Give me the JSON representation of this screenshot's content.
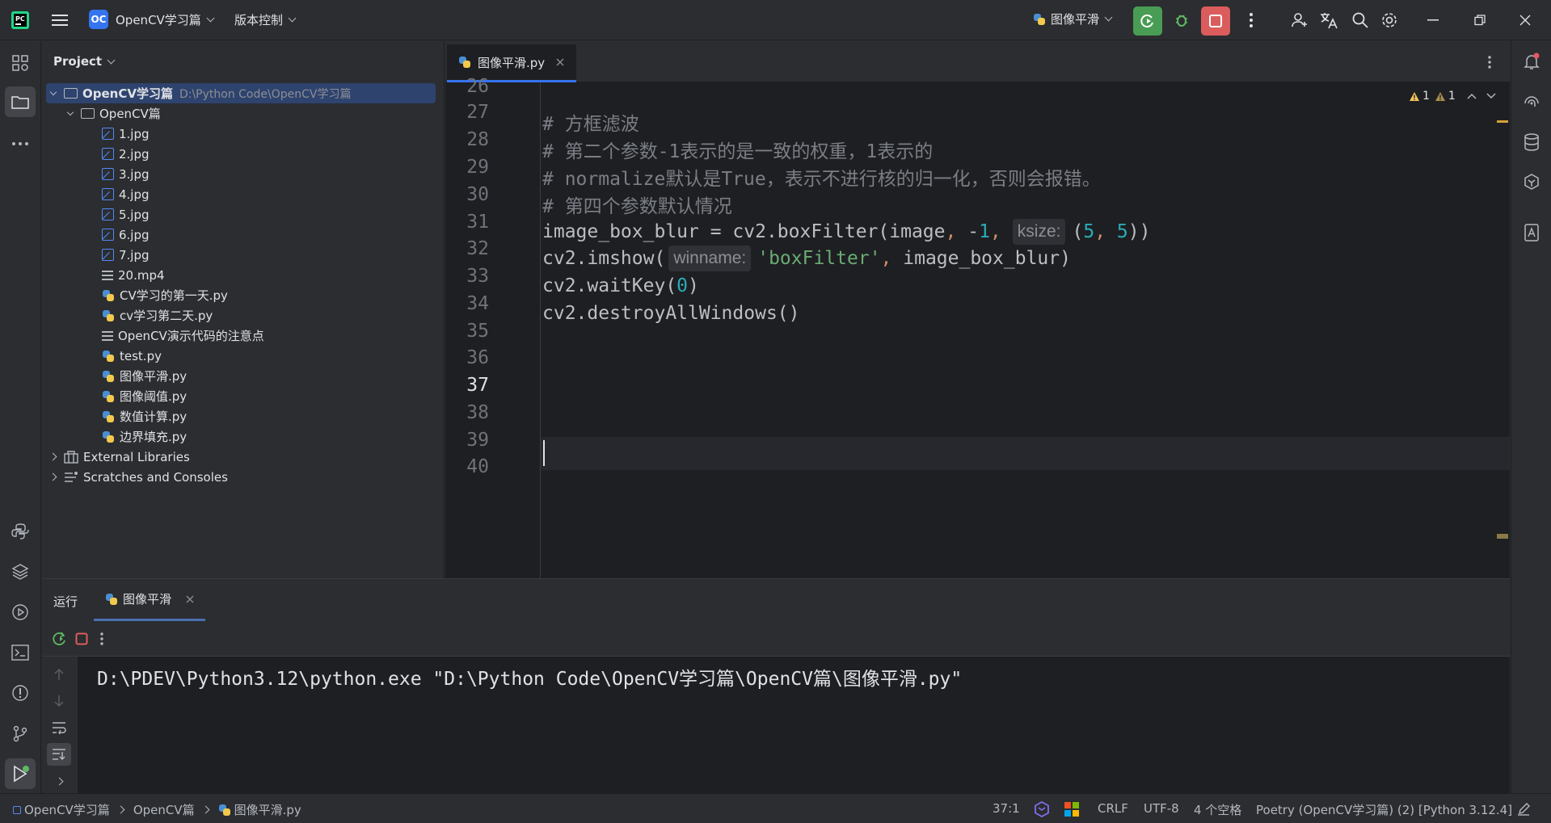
{
  "titlebar": {
    "project_badge": "OC",
    "project_name": "OpenCV学习篇",
    "vcs": "版本控制",
    "run_config": "图像平滑"
  },
  "project_panel": {
    "title": "Project",
    "root_name": "OpenCV学习篇",
    "root_path": "D:\\Python Code\\OpenCV学习篇",
    "folder": "OpenCV篇",
    "files": [
      {
        "name": "1.jpg",
        "type": "jpg"
      },
      {
        "name": "2.jpg",
        "type": "jpg"
      },
      {
        "name": "3.jpg",
        "type": "jpg"
      },
      {
        "name": "4.jpg",
        "type": "jpg"
      },
      {
        "name": "5.jpg",
        "type": "jpg"
      },
      {
        "name": "6.jpg",
        "type": "jpg"
      },
      {
        "name": "7.jpg",
        "type": "jpg"
      },
      {
        "name": "20.mp4",
        "type": "text"
      },
      {
        "name": "CV学习的第一天.py",
        "type": "py"
      },
      {
        "name": "cv学习第二天.py",
        "type": "py"
      },
      {
        "name": "OpenCV演示代码的注意点",
        "type": "text"
      },
      {
        "name": "test.py",
        "type": "py"
      },
      {
        "name": "图像平滑.py",
        "type": "py"
      },
      {
        "name": "图像阈值.py",
        "type": "py"
      },
      {
        "name": "数值计算.py",
        "type": "py"
      },
      {
        "name": "边界填充.py",
        "type": "py"
      }
    ],
    "external_libraries": "External Libraries",
    "scratches": "Scratches and Consoles"
  },
  "editor": {
    "tab_label": "图像平滑.py",
    "warnings": "1",
    "weak_warnings": "1",
    "line_numbers": [
      "26",
      "27",
      "28",
      "29",
      "30",
      "31",
      "32",
      "33",
      "34",
      "35",
      "36",
      "37",
      "38",
      "39",
      "40"
    ],
    "current_line": "37",
    "code": {
      "l27": "# 方框滤波",
      "l28": "# 第二个参数-1表示的是一致的权重，1表示的",
      "l29": "# normalize默认是True，表示不进行核的归一化，否则会报错。",
      "l30": "# 第四个参数默认情况",
      "l31_a": "image_box_blur = cv2.boxFilter(image",
      "l31_comma1": ",",
      "l31_b": " -",
      "l31_n1": "1",
      "l31_comma2": ",",
      "l31_hint": "ksize:",
      "l31_c": "(",
      "l31_n2": "5",
      "l31_comma3": ",",
      "l31_n3": " 5",
      "l31_d": "))",
      "l32_a": "cv2.imshow(",
      "l32_hint": "winname:",
      "l32_str": "'boxFilter'",
      "l32_comma": ",",
      "l32_b": " image_box_blur)",
      "l33_a": "cv2.waitKey(",
      "l33_n": "0",
      "l33_b": ")",
      "l34": "cv2.destroyAllWindows()"
    }
  },
  "run_panel": {
    "title": "运行",
    "tab_label": "图像平滑",
    "output": "D:\\PDEV\\Python3.12\\python.exe \"D:\\Python Code\\OpenCV学习篇\\OpenCV篇\\图像平滑.py\""
  },
  "statusbar": {
    "breadcrumb": [
      "OpenCV学习篇",
      "OpenCV篇",
      "图像平滑.py"
    ],
    "position": "37:1",
    "line_sep": "CRLF",
    "encoding": "UTF-8",
    "indent": "4 个空格",
    "interpreter": "Poetry (OpenCV学习篇) (2) [Python 3.12.4]"
  },
  "colors": {
    "accent": "#3574f0",
    "run_green": "#499c54",
    "stop_red": "#db5c5c",
    "warning": "#f2c55c"
  }
}
